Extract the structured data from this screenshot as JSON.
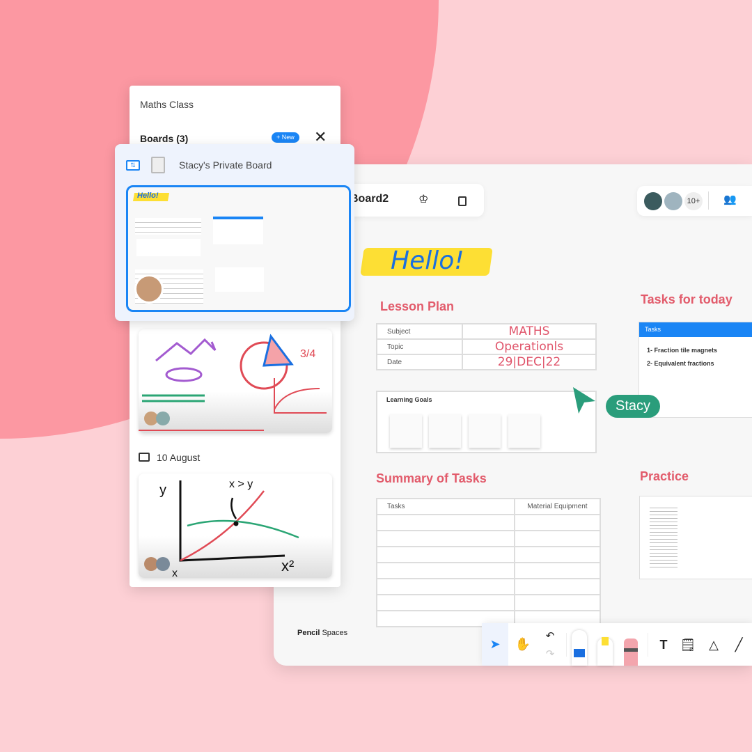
{
  "colors": {
    "accent": "#1a85f5",
    "heading": "#e25b6b",
    "cursor": "#2a9d7b",
    "bg": "#fdd0d5",
    "blob": "#fc98a2"
  },
  "panel": {
    "title": "Maths Class",
    "boards_label": "Boards (3)",
    "new_button": "+ New",
    "close_icon": "close-icon",
    "selected_board": {
      "name": "Stacy's Private Board"
    },
    "date_label": "10 August"
  },
  "board": {
    "title": "Board2",
    "participants_more": "10+",
    "hello": "Hello!",
    "lesson_plan": {
      "title": "Lesson Plan",
      "rows": [
        {
          "label": "Subject",
          "value": "MATHS"
        },
        {
          "label": "Topic",
          "value": "Operationls"
        },
        {
          "label": "Date",
          "value": "29|DEC|22"
        }
      ]
    },
    "learning_goals": "Learning Goals",
    "tasks_for_today": {
      "title": "Tasks for today",
      "header": "Tasks",
      "items": [
        "1- Fraction tile magnets",
        "2- Equivalent fractions"
      ]
    },
    "summary": {
      "title": "Summary of Tasks",
      "columns": [
        "Tasks",
        "Material Equipment"
      ],
      "row_count": 7
    },
    "practice": {
      "title": "Practice"
    },
    "cursor_label": "Stacy",
    "brand_bold": "Pencil",
    "brand_rest": " Spaces"
  },
  "toolbar": {
    "tools": [
      "select",
      "hand",
      "undo",
      "redo",
      "pen",
      "highlighter",
      "eraser",
      "text",
      "sticky-note",
      "shapes",
      "line"
    ],
    "text_tool": "T"
  }
}
